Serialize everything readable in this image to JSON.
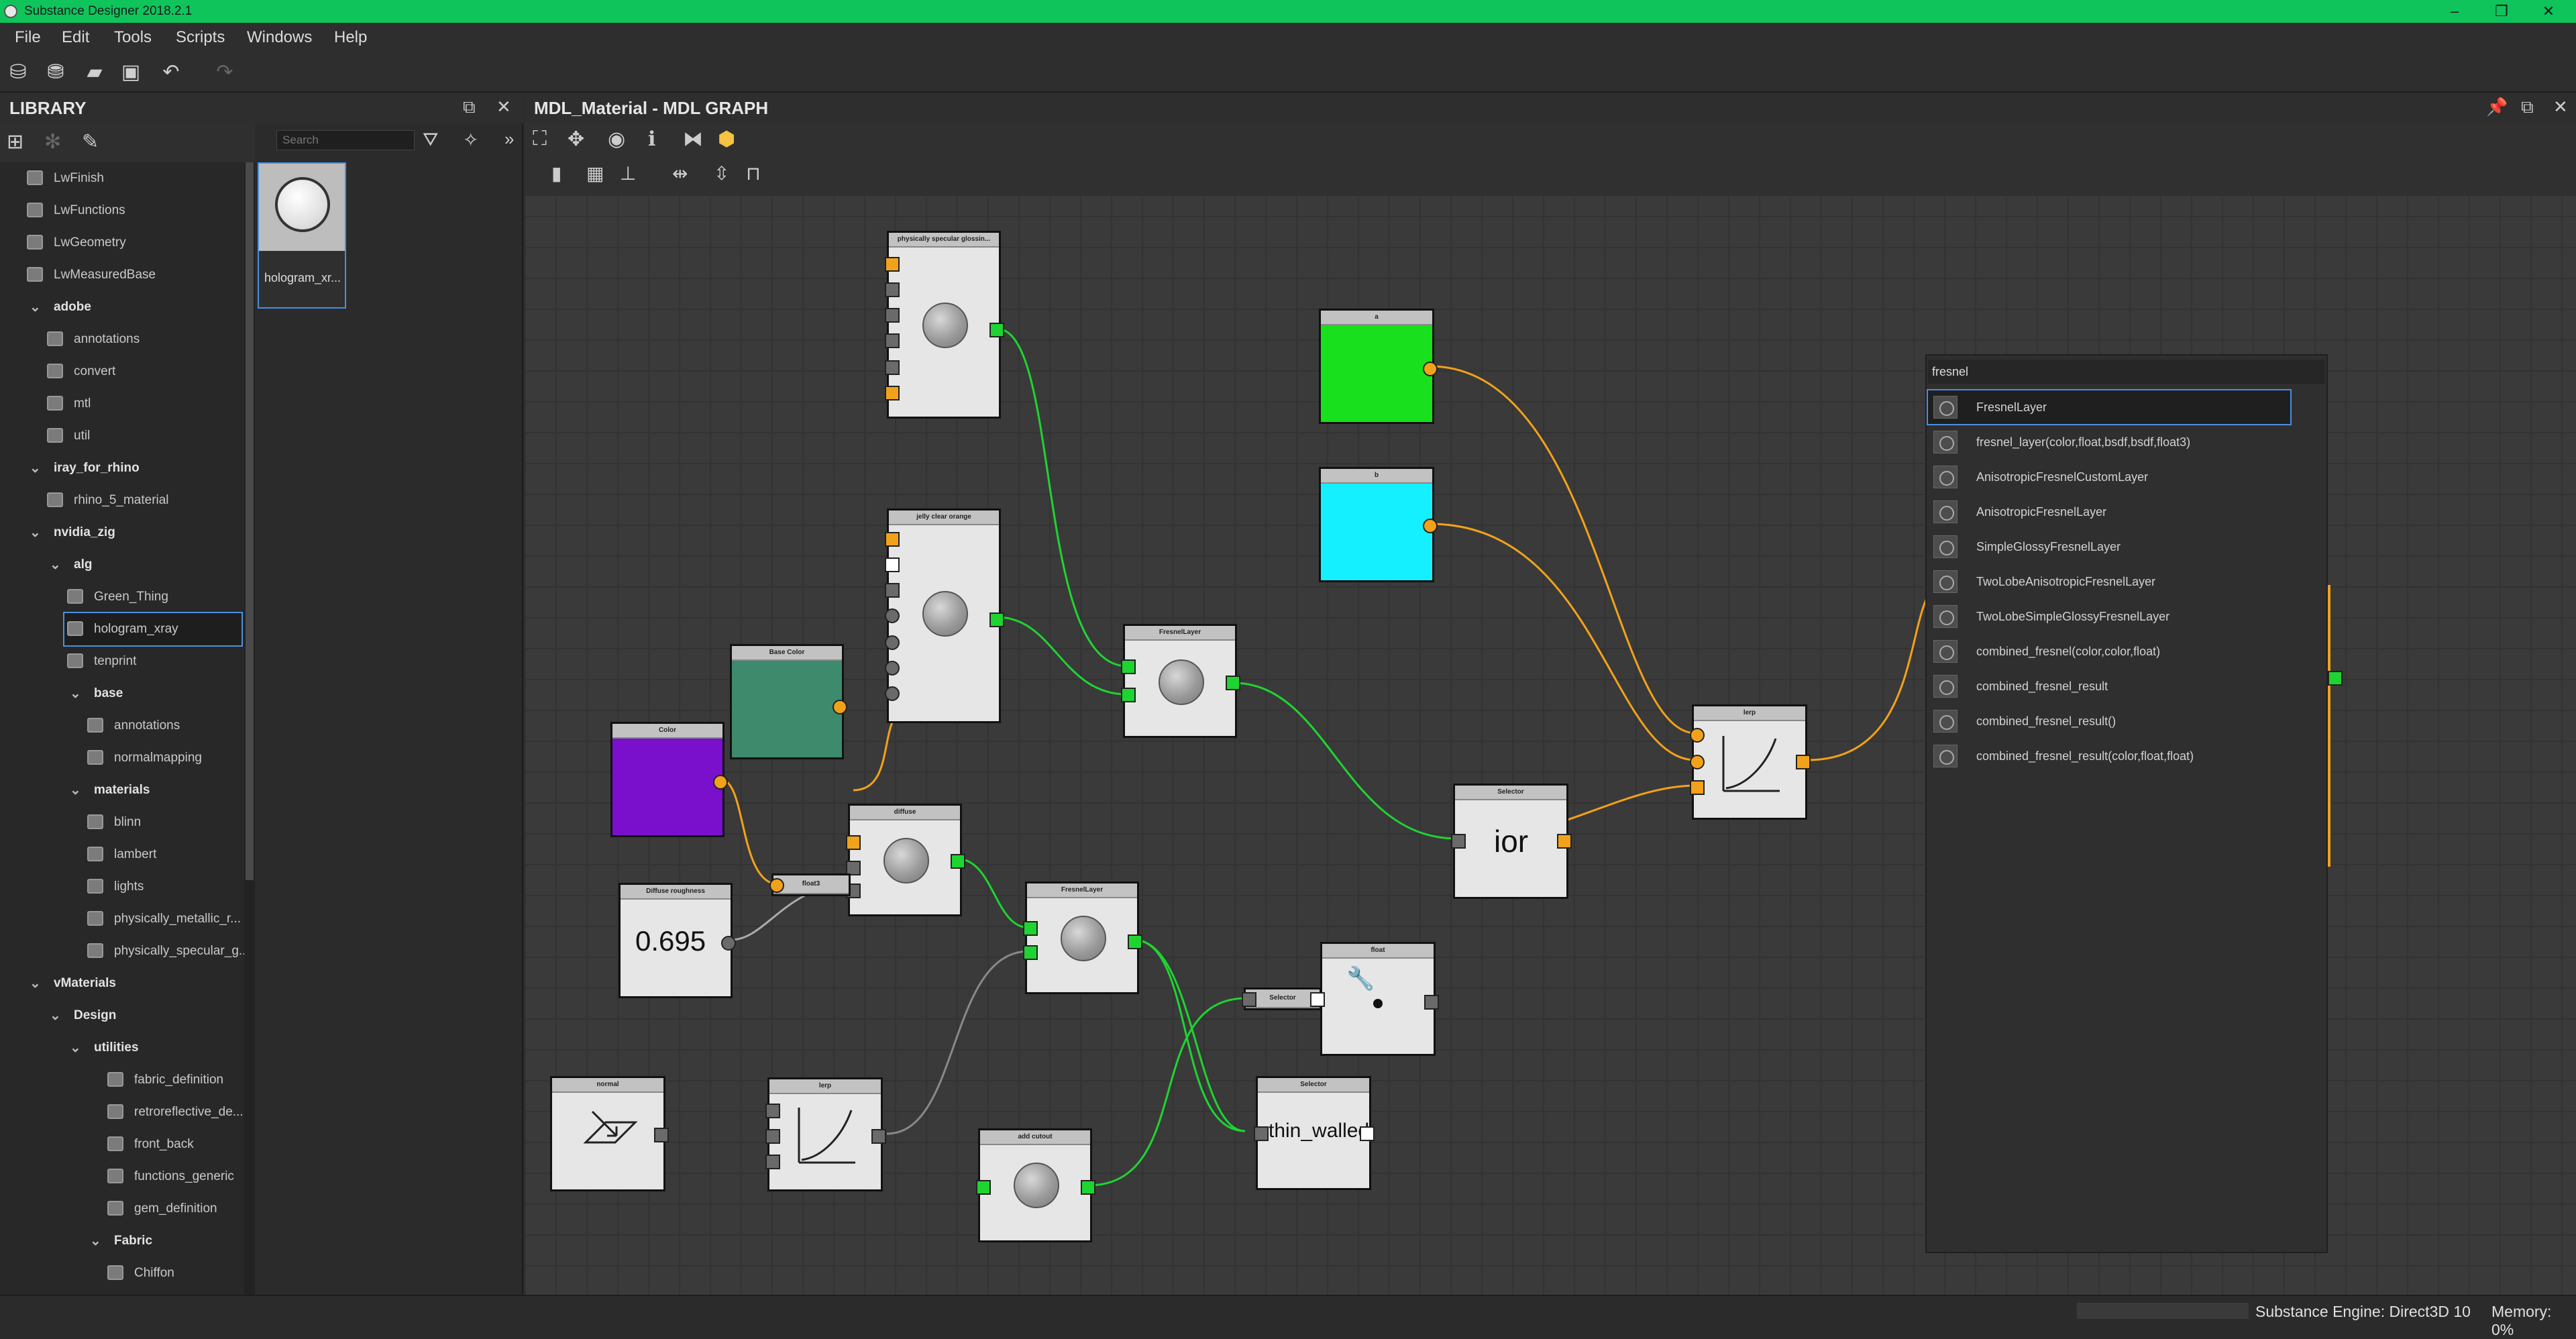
{
  "app": {
    "title": "Substance Designer 2018.2.1"
  },
  "menu": [
    "File",
    "Edit",
    "Tools",
    "Scripts",
    "Windows",
    "Help"
  ],
  "library": {
    "title": "LIBRARY",
    "search_placeholder": "Search",
    "thumb_label": "hologram_xr...",
    "tree": [
      {
        "label": "LwFinish",
        "bold": false
      },
      {
        "label": "LwFunctions",
        "bold": false
      },
      {
        "label": "LwGeometry",
        "bold": false
      },
      {
        "label": "LwMeasuredBase",
        "bold": false
      },
      {
        "label": "adobe",
        "bold": true
      },
      {
        "label": "annotations",
        "bold": false
      },
      {
        "label": "convert",
        "bold": false
      },
      {
        "label": "mtl",
        "bold": false
      },
      {
        "label": "util",
        "bold": false
      },
      {
        "label": "iray_for_rhino",
        "bold": true
      },
      {
        "label": "rhino_5_material",
        "bold": false
      },
      {
        "label": "nvidia_zig",
        "bold": true
      },
      {
        "label": "alg",
        "bold": true
      },
      {
        "label": "Green_Thing",
        "bold": false
      },
      {
        "label": "hologram_xray",
        "bold": false,
        "selected": true
      },
      {
        "label": "tenprint",
        "bold": false
      },
      {
        "label": "base",
        "bold": true
      },
      {
        "label": "annotations",
        "bold": false
      },
      {
        "label": "normalmapping",
        "bold": false
      },
      {
        "label": "materials",
        "bold": true
      },
      {
        "label": "blinn",
        "bold": false
      },
      {
        "label": "lambert",
        "bold": false
      },
      {
        "label": "lights",
        "bold": false
      },
      {
        "label": "physically_metallic_r...",
        "bold": false
      },
      {
        "label": "physically_specular_g...",
        "bold": false
      },
      {
        "label": "vMaterials",
        "bold": true
      },
      {
        "label": "Design",
        "bold": true
      },
      {
        "label": "utilities",
        "bold": true
      },
      {
        "label": "fabric_definition",
        "bold": false
      },
      {
        "label": "retroreflective_de...",
        "bold": false
      },
      {
        "label": "front_back",
        "bold": false
      },
      {
        "label": "functions_generic",
        "bold": false
      },
      {
        "label": "gem_definition",
        "bold": false
      },
      {
        "label": "Fabric",
        "bold": true
      },
      {
        "label": "Chiffon",
        "bold": false
      }
    ]
  },
  "graph": {
    "title": "MDL_Material - MDL GRAPH",
    "nodes": {
      "phys_spec": "physically specular glossin...",
      "jelly": "jelly clear orange",
      "fresnel1": "FresnelLayer",
      "fresnel2": "FresnelLayer",
      "base_color": "Base Color",
      "color": "Color",
      "diffuse": "diffuse",
      "float3": "float3",
      "diffuse_roughness": "Diffuse roughness",
      "diffuse_roughness_value": "0.695",
      "a": "a",
      "b": "b",
      "lerp1": "lerp",
      "selector_ior": "Selector",
      "ior_label": "ior",
      "float_node": "float",
      "selector_small": "Selector",
      "selector_thin": "Selector",
      "thin_walled_label": "thin_walled",
      "normal": "normal",
      "lerp2": "lerp",
      "add_cutout": "add cutout"
    }
  },
  "popup": {
    "query": "fresnel",
    "items": [
      {
        "label": "FresnelLayer",
        "selected": true
      },
      {
        "label": "fresnel_layer(color,float,bsdf,bsdf,float3)"
      },
      {
        "label": "AnisotropicFresnelCustomLayer"
      },
      {
        "label": "AnisotropicFresnelLayer"
      },
      {
        "label": "SimpleGlossyFresnelLayer"
      },
      {
        "label": "TwoLobeAnisotropicFresnelLayer"
      },
      {
        "label": "TwoLobeSimpleGlossyFresnelLayer"
      },
      {
        "label": "combined_fresnel(color,color,float)"
      },
      {
        "label": "combined_fresnel_result"
      },
      {
        "label": "combined_fresnel_result()"
      },
      {
        "label": "combined_fresnel_result(color,float,float)"
      }
    ]
  },
  "status": {
    "engine": "Substance Engine: Direct3D 10",
    "memory": "Memory: 0%"
  },
  "colors": {
    "titlebar": "#10c45c",
    "selection": "#4a8fe0",
    "port_green": "#1ed431",
    "port_orange": "#f2a21a",
    "node_a": "#19e01c",
    "node_b": "#14f0ff",
    "base_color": "#3d8a6c",
    "color_purple": "#7a0fcc"
  }
}
